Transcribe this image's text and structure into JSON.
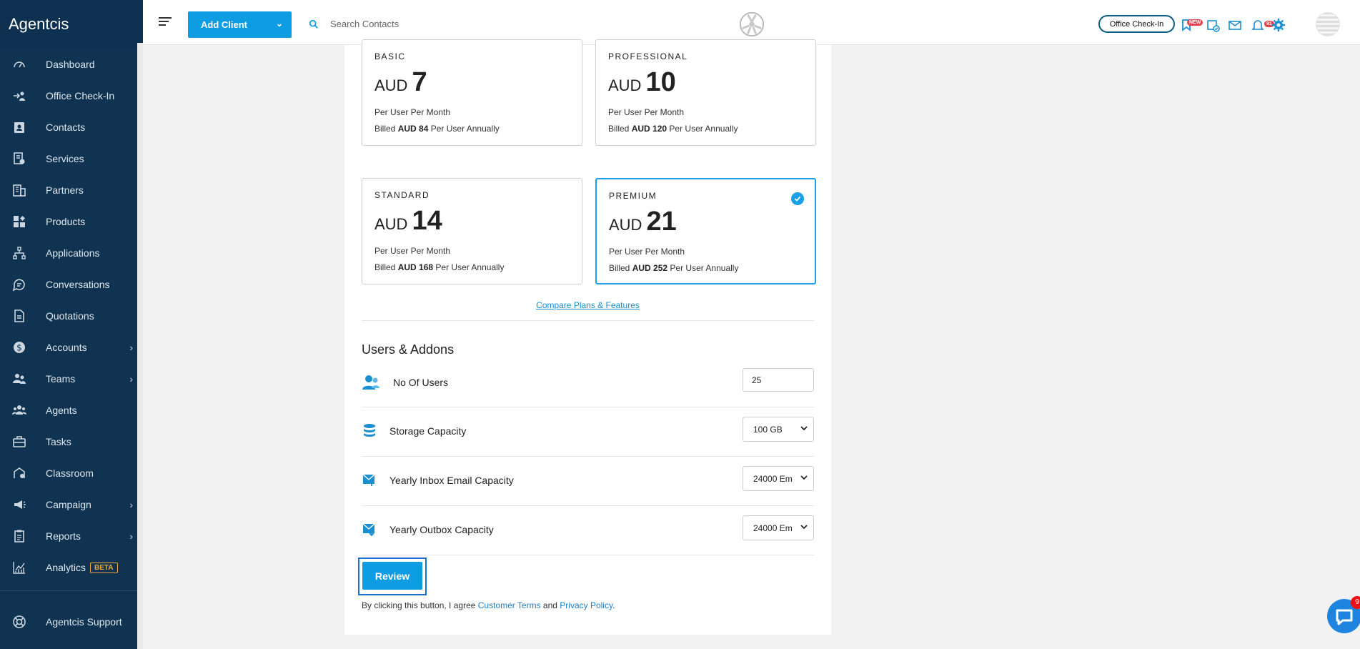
{
  "app": {
    "name": "Agentcis"
  },
  "sidebar": {
    "items": [
      {
        "label": "Dashboard",
        "icon": "dashboard-icon",
        "chevron": false
      },
      {
        "label": "Office Check-In",
        "icon": "checkin-icon",
        "chevron": false
      },
      {
        "label": "Contacts",
        "icon": "contacts-icon",
        "chevron": false
      },
      {
        "label": "Services",
        "icon": "services-icon",
        "chevron": false
      },
      {
        "label": "Partners",
        "icon": "partners-icon",
        "chevron": false
      },
      {
        "label": "Products",
        "icon": "products-icon",
        "chevron": false
      },
      {
        "label": "Applications",
        "icon": "applications-icon",
        "chevron": false
      },
      {
        "label": "Conversations",
        "icon": "conversations-icon",
        "chevron": false
      },
      {
        "label": "Quotations",
        "icon": "quotations-icon",
        "chevron": false
      },
      {
        "label": "Accounts",
        "icon": "accounts-icon",
        "chevron": true
      },
      {
        "label": "Teams",
        "icon": "teams-icon",
        "chevron": true
      },
      {
        "label": "Agents",
        "icon": "agents-icon",
        "chevron": false
      },
      {
        "label": "Tasks",
        "icon": "tasks-icon",
        "chevron": false
      },
      {
        "label": "Classroom",
        "icon": "classroom-icon",
        "chevron": false
      },
      {
        "label": "Campaign",
        "icon": "campaign-icon",
        "chevron": true
      },
      {
        "label": "Reports",
        "icon": "reports-icon",
        "chevron": true
      },
      {
        "label": "Analytics",
        "icon": "analytics-icon",
        "chevron": false,
        "badge": "BETA"
      }
    ],
    "support_label": "Agentcis Support"
  },
  "topbar": {
    "add_client_label": "Add Client",
    "search_placeholder": "Search Contacts",
    "checkin_label": "Office Check-In",
    "new_badge": "NEW",
    "notification_count": "91"
  },
  "plans": [
    {
      "name": "BASIC",
      "currency": "AUD",
      "amount": "7",
      "per": "Per User Per Month",
      "billed_prefix": "Billed",
      "billed_amount": "AUD 84",
      "billed_suffix": "Per User Annually",
      "selected": false
    },
    {
      "name": "PROFESSIONAL",
      "currency": "AUD",
      "amount": "10",
      "per": "Per User Per Month",
      "billed_prefix": "Billed",
      "billed_amount": "AUD 120",
      "billed_suffix": "Per User Annually",
      "selected": false
    },
    {
      "name": "STANDARD",
      "currency": "AUD",
      "amount": "14",
      "per": "Per User Per Month",
      "billed_prefix": "Billed",
      "billed_amount": "AUD 168",
      "billed_suffix": "Per User Annually",
      "selected": false
    },
    {
      "name": "PREMIUM",
      "currency": "AUD",
      "amount": "21",
      "per": "Per User Per Month",
      "billed_prefix": "Billed",
      "billed_amount": "AUD 252",
      "billed_suffix": "Per User Annually",
      "selected": true
    }
  ],
  "compare_link": "Compare Plans & Features",
  "addons": {
    "title": "Users & Addons",
    "users_label": "No Of Users",
    "users_value": "25",
    "storage_label": "Storage Capacity",
    "storage_value": "100 GB",
    "inbox_label": "Yearly Inbox Email Capacity",
    "inbox_value": "24000 Em",
    "outbox_label": "Yearly Outbox Capacity",
    "outbox_value": "24000 Em"
  },
  "review": {
    "button_label": "Review",
    "terms_prefix": "By clicking this button, I agree",
    "customer_terms": "Customer Terms",
    "and": "and",
    "privacy_policy": "Privacy Policy",
    "period": "."
  },
  "chat": {
    "badge": "9"
  },
  "colors": {
    "sidebar": "#0f3350",
    "accent": "#0e9ce3",
    "selected_border": "#1aa0e6"
  }
}
